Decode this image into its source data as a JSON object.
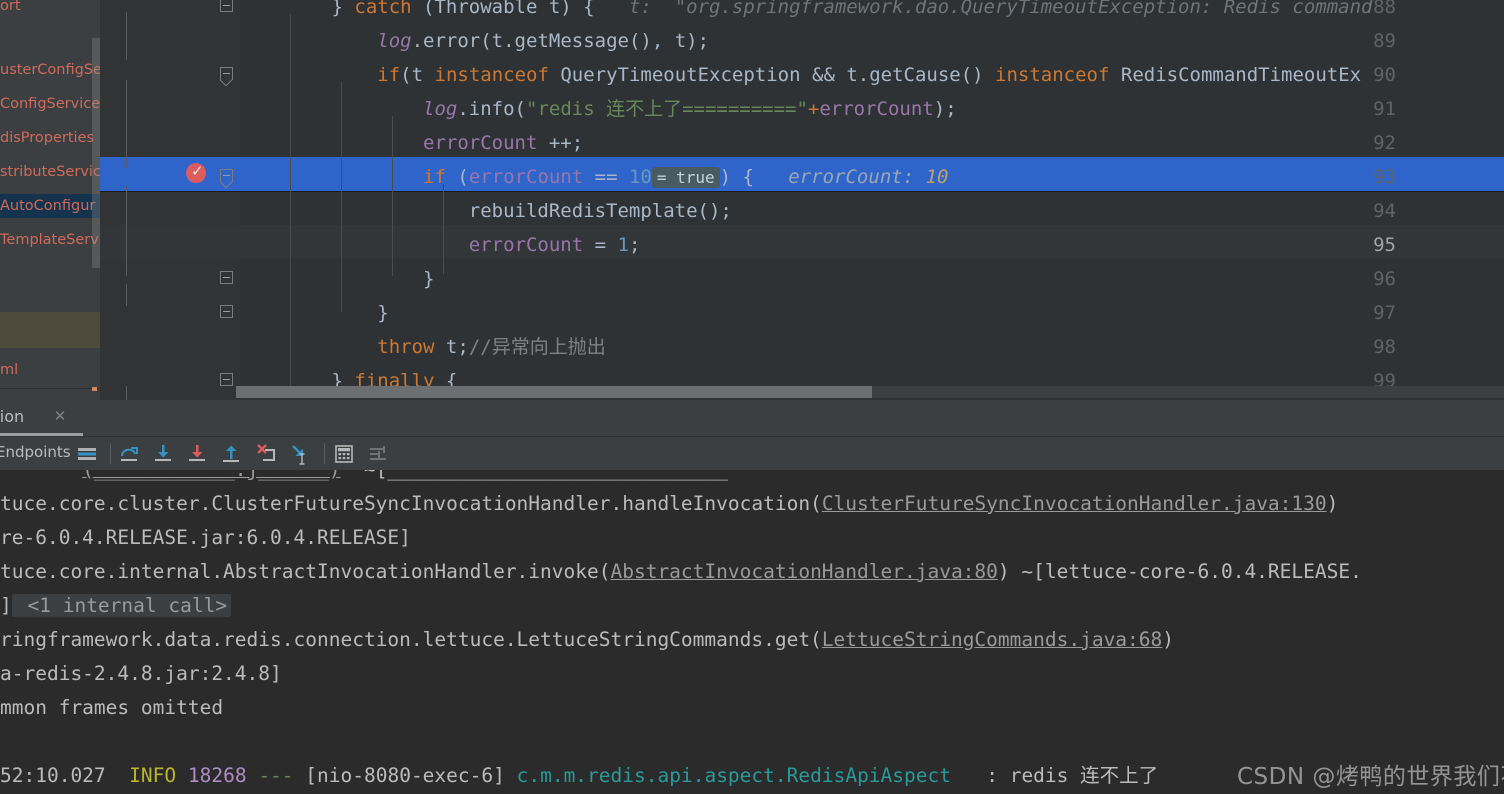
{
  "editor": {
    "project_panel": {
      "items": [
        {
          "label": "ort",
          "state": "normal"
        },
        {
          "label": "usterConfigSer",
          "state": "normal"
        },
        {
          "label": "ConfigService",
          "state": "normal"
        },
        {
          "label": "disProperties",
          "state": "normal"
        },
        {
          "label": "stributeServic",
          "state": "normal"
        },
        {
          "label": "AutoConfigur",
          "state": "selected"
        },
        {
          "label": "TemplateServ",
          "state": "normal"
        },
        {
          "label": "",
          "state": "olive"
        },
        {
          "label": "ml",
          "state": "normal"
        }
      ]
    },
    "lines": [
      {
        "number": "88",
        "tokens": [
          {
            "t": "        } ",
            "c": "plain"
          },
          {
            "t": "catch ",
            "c": "kw"
          },
          {
            "t": "(Throwable t) {",
            "c": "plain"
          },
          {
            "t": "   t:  \"org.springframework.dao.QueryTimeoutException: Redis command",
            "c": "hint"
          }
        ]
      },
      {
        "number": "89",
        "tokens": [
          {
            "t": "            ",
            "c": "plain"
          },
          {
            "t": "log",
            "c": "logv"
          },
          {
            "t": ".error(t.getMessage(), t);",
            "c": "plain"
          }
        ]
      },
      {
        "number": "90",
        "tokens": [
          {
            "t": "            ",
            "c": "plain"
          },
          {
            "t": "if",
            "c": "kw"
          },
          {
            "t": "(t ",
            "c": "plain"
          },
          {
            "t": "instanceof ",
            "c": "kw"
          },
          {
            "t": "QueryTimeoutException && t.getCause() ",
            "c": "plain"
          },
          {
            "t": "instanceof ",
            "c": "kw"
          },
          {
            "t": "RedisCommandTimeoutEx",
            "c": "plain"
          }
        ]
      },
      {
        "number": "91",
        "tokens": [
          {
            "t": "                ",
            "c": "plain"
          },
          {
            "t": "log",
            "c": "logv"
          },
          {
            "t": ".info(",
            "c": "plain"
          },
          {
            "t": "\"redis 连不上了==========\"",
            "c": "str"
          },
          {
            "t": "+",
            "c": "kw"
          },
          {
            "t": "errorCount",
            "c": "fld"
          },
          {
            "t": ");",
            "c": "plain"
          }
        ]
      },
      {
        "number": "92",
        "tokens": [
          {
            "t": "                ",
            "c": "plain"
          },
          {
            "t": "errorCount",
            "c": "fld"
          },
          {
            "t": " ++;",
            "c": "plain"
          }
        ]
      },
      {
        "number": "93",
        "highlighted": true,
        "breakpoint": true,
        "tokens": [
          {
            "t": "                ",
            "c": "plain"
          },
          {
            "t": "if",
            "c": "kw"
          },
          {
            "t": " (",
            "c": "plain"
          },
          {
            "t": "errorCount",
            "c": "fld"
          },
          {
            "t": " == ",
            "c": "plain"
          },
          {
            "t": "10",
            "c": "num"
          },
          {
            "t": "= true",
            "c": "inlay"
          },
          {
            "t": ") {",
            "c": "plain"
          },
          {
            "t": "   errorCount: ",
            "c": "hint2"
          },
          {
            "t": "10",
            "c": "hintnum"
          }
        ]
      },
      {
        "number": "94",
        "tokens": [
          {
            "t": "                    rebuildRedisTemplate();",
            "c": "plain"
          }
        ]
      },
      {
        "number": "95",
        "current": true,
        "tokens": [
          {
            "t": "                    ",
            "c": "plain"
          },
          {
            "t": "errorCount",
            "c": "fld"
          },
          {
            "t": " = ",
            "c": "plain"
          },
          {
            "t": "1",
            "c": "num"
          },
          {
            "t": ";",
            "c": "plain"
          }
        ]
      },
      {
        "number": "96",
        "tokens": [
          {
            "t": "                }",
            "c": "plain"
          }
        ]
      },
      {
        "number": "97",
        "tokens": [
          {
            "t": "            }",
            "c": "plain"
          }
        ]
      },
      {
        "number": "98",
        "tokens": [
          {
            "t": "            ",
            "c": "plain"
          },
          {
            "t": "throw ",
            "c": "kw"
          },
          {
            "t": "t;",
            "c": "plain"
          },
          {
            "t": "//异常向上抛出",
            "c": "cmt"
          }
        ]
      },
      {
        "number": "99",
        "tokens": [
          {
            "t": "        } ",
            "c": "plain"
          },
          {
            "t": "finally",
            "c": "kw"
          },
          {
            "t": " {",
            "c": "plain"
          }
        ]
      }
    ]
  },
  "run_panel": {
    "tab": {
      "label": "lication",
      "close_icon": "close-icon"
    },
    "toolbar": {
      "endpoints_label": "Endpoints",
      "buttons": [
        {
          "name": "endpoints-icon",
          "title": "Endpoints"
        },
        {
          "name": "step-over-icon",
          "title": "Step Over"
        },
        {
          "name": "step-into-icon",
          "title": "Step Into"
        },
        {
          "name": "force-step-into-icon",
          "title": "Force Step Into"
        },
        {
          "name": "step-out-icon",
          "title": "Step Out"
        },
        {
          "name": "drop-frame-icon",
          "title": "Drop Frame"
        },
        {
          "name": "run-to-cursor-icon",
          "title": "Run to Cursor"
        },
        {
          "name": "evaluate-expression-icon",
          "title": "Evaluate Expression"
        },
        {
          "name": "sort-icon",
          "title": "Settings"
        }
      ]
    },
    "console": {
      "lines": [
        {
          "id": "line-0",
          "segments": [
            {
              "t": "       ",
              "c": "msg"
            },
            {
              "t": "(____________.j______)",
              "c": "lnk"
            },
            {
              "t": "  ~[_____________________________",
              "c": "msg"
            }
          ]
        },
        {
          "id": "line-1",
          "segments": [
            {
              "t": "tuce.core.cluster.ClusterFutureSyncInvocationHandler.handleInvocation(",
              "c": "msg"
            },
            {
              "t": "ClusterFutureSyncInvocationHandler.java:130",
              "c": "lnk"
            },
            {
              "t": ")",
              "c": "msg"
            }
          ]
        },
        {
          "id": "line-2",
          "segments": [
            {
              "t": "re-6.0.4.RELEASE.jar:6.0.4.RELEASE]",
              "c": "msg"
            }
          ]
        },
        {
          "id": "line-3",
          "segments": [
            {
              "t": "tuce.core.internal.AbstractInvocationHandler.invoke(",
              "c": "msg"
            },
            {
              "t": "AbstractInvocationHandler.java:80",
              "c": "lnk"
            },
            {
              "t": ") ~[lettuce-core-6.0.4.RELEASE.",
              "c": "msg"
            }
          ]
        },
        {
          "id": "line-4",
          "segments": [
            {
              "t": "]",
              "c": "msg"
            },
            {
              "t": " <1 internal call>",
              "c": "fold-chip"
            }
          ]
        },
        {
          "id": "line-5",
          "segments": [
            {
              "t": "ringframework.data.redis.connection.lettuce.LettuceStringCommands.get(",
              "c": "msg"
            },
            {
              "t": "LettuceStringCommands.java:68",
              "c": "lnk"
            },
            {
              "t": ")",
              "c": "msg"
            }
          ]
        },
        {
          "id": "line-6",
          "segments": [
            {
              "t": "a-redis-2.4.8.jar:2.4.8]",
              "c": "msg"
            }
          ]
        },
        {
          "id": "line-7",
          "segments": [
            {
              "t": "mmon frames omitted",
              "c": "msg"
            }
          ]
        },
        {
          "id": "line-8",
          "segments": []
        },
        {
          "id": "line-9",
          "segments": [
            {
              "t": "52:10.027  ",
              "c": "msg"
            },
            {
              "t": "INFO",
              "c": "lvl-info"
            },
            {
              "t": " ",
              "c": "msg"
            },
            {
              "t": "18268",
              "c": "pid"
            },
            {
              "t": " ",
              "c": "msg"
            },
            {
              "t": "---",
              "c": "dash"
            },
            {
              "t": " [nio-8080-exec-6] ",
              "c": "thread"
            },
            {
              "t": "c.m.m.redis.api.aspect.RedisApiAspect",
              "c": "logger"
            },
            {
              "t": "   : redis 连不上了",
              "c": "msg"
            }
          ]
        }
      ]
    }
  },
  "watermark": {
    "text": "CSDN @烤鸭的世界我们不懂"
  },
  "colors": {
    "editor_bg": "#2f3234",
    "gutter_bg": "#313335",
    "panel_bg": "#3c3f41",
    "console_bg": "#2b2b2b",
    "highlight_row": "#2f65ca",
    "keyword": "#cc7832",
    "field": "#9876aa",
    "string": "#6a8759",
    "number": "#6897bb",
    "breakpoint": "#db5c5c",
    "accent_blue": "#3592c4",
    "accent_red": "#db5c5c",
    "logger": "#299999",
    "info_level": "#bbb529"
  }
}
